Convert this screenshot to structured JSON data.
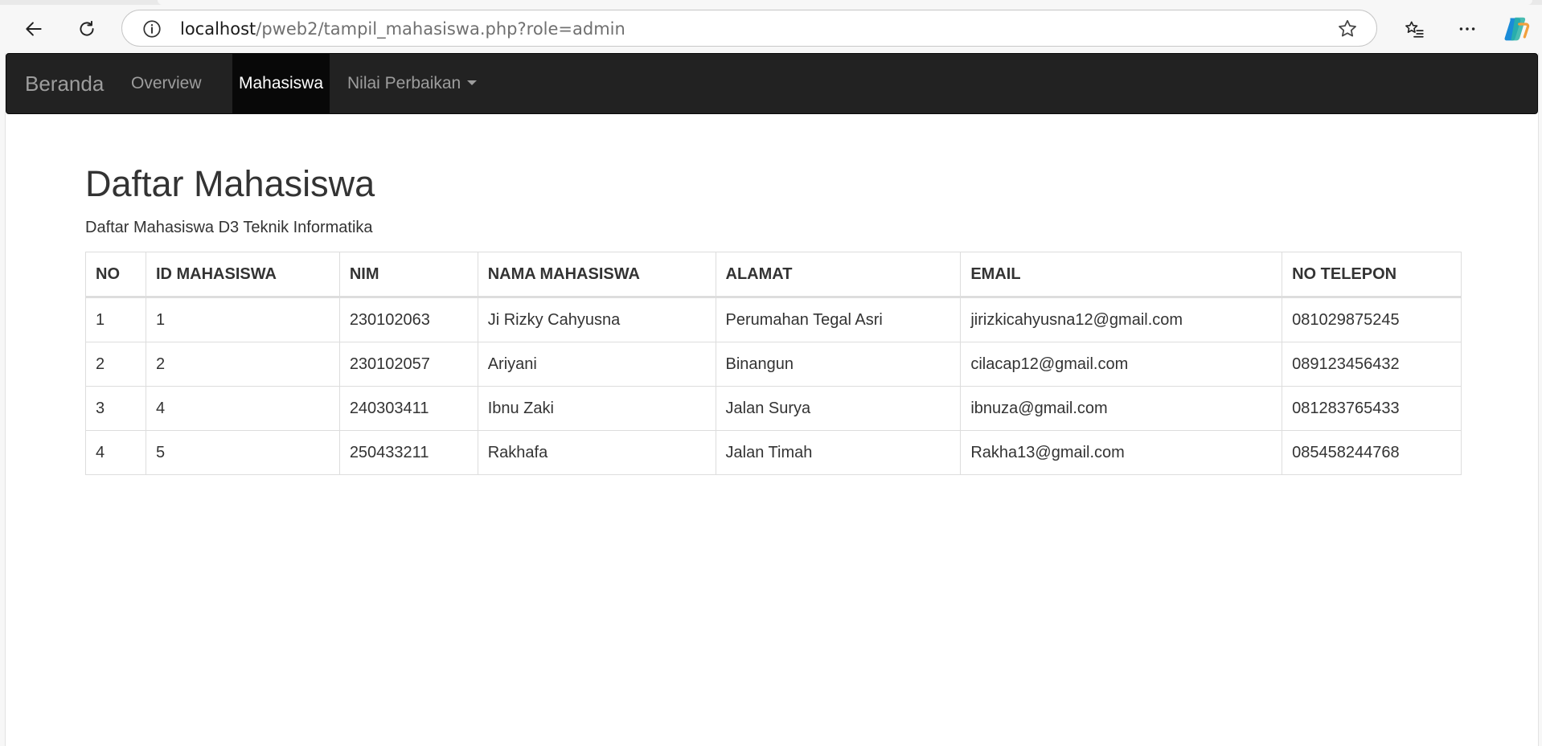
{
  "browser": {
    "url_host": "localhost",
    "url_path": "/pweb2/tampil_mahasiswa.php?role=admin"
  },
  "navbar": {
    "brand": "Beranda",
    "items": [
      {
        "label": "Overview"
      },
      {
        "label": "Mahasiswa"
      },
      {
        "label": "Nilai Perbaikan"
      }
    ]
  },
  "page": {
    "title": "Daftar Mahasiswa",
    "subtitle": "Daftar Mahasiswa D3 Teknik Informatika"
  },
  "table": {
    "headers": [
      "NO",
      "ID MAHASISWA",
      "NIM",
      "NAMA MAHASISWA",
      "ALAMAT",
      "EMAIL",
      "NO TELEPON"
    ],
    "rows": [
      [
        "1",
        "1",
        "230102063",
        "Ji Rizky Cahyusna",
        "Perumahan Tegal Asri",
        "jirizkicahyusna12@gmail.com",
        "081029875245"
      ],
      [
        "2",
        "2",
        "230102057",
        "Ariyani",
        "Binangun",
        "cilacap12@gmail.com",
        "089123456432"
      ],
      [
        "3",
        "4",
        "240303411",
        "Ibnu Zaki",
        "Jalan Surya",
        "ibnuza@gmail.com",
        "081283765433"
      ],
      [
        "4",
        "5",
        "250433211",
        "Rakhafa",
        "Jalan Timah",
        "Rakha13@gmail.com",
        "085458244768"
      ]
    ]
  }
}
